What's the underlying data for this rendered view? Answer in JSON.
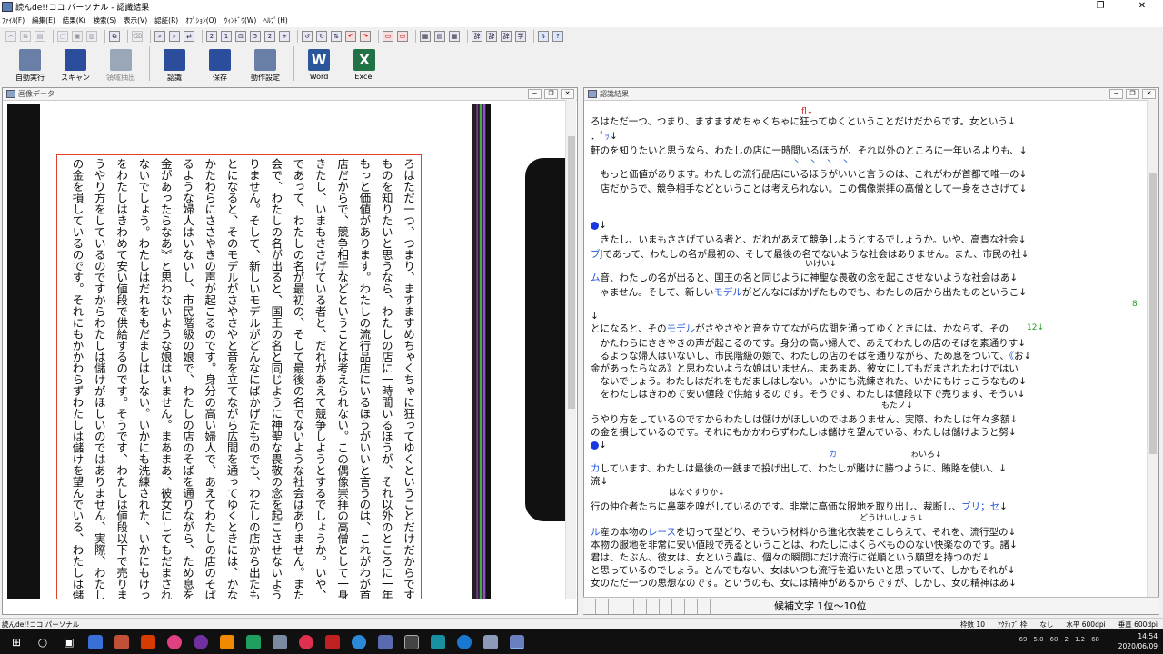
{
  "window": {
    "title": "読んde!!ココ パーソナル - 認識結果",
    "min": "─",
    "max": "❐",
    "close": "✕"
  },
  "menu": [
    "ﾌｧｲﾙ(F)",
    "編集(E)",
    "結果(K)",
    "検索(S)",
    "表示(V)",
    "認証(R)",
    "ｵﾌﾟｼｮﾝ(O)",
    "ｳｨﾝﾄﾞｳ(W)",
    "ﾍﾙﾌﾟ(H)"
  ],
  "toolbar2": [
    {
      "label": "自動実行",
      "color": "#6a7fa8"
    },
    {
      "label": "スキャン",
      "color": "#2c4c9c"
    },
    {
      "label": "領域抽出",
      "color": "#9aa7b8"
    },
    {
      "label": "認識",
      "color": "#2c4c9c"
    },
    {
      "label": "保存",
      "color": "#2c4c9c"
    },
    {
      "label": "動作設定",
      "color": "#6a7fa8"
    },
    {
      "label": "Word",
      "color": "#2b579a",
      "letter": "W"
    },
    {
      "label": "Excel",
      "color": "#217346",
      "letter": "X"
    }
  ],
  "image_panel": {
    "title": "画像データ"
  },
  "result_panel": {
    "title": "認識結果"
  },
  "vertical_text": [
    "ろはただ一つ、つまり、ますますめちゃくちゃに狂ってゆくということだけだからです",
    "ものを知りたいと思うなら、わたしの店に一時間いるほうが、それ以外のところに一年",
    "もっと価値があります。わたしの流行品店にいるほうがいいと言うのは、これがわが首",
    "店だからで、競争相手などということは考えられない。この偶像崇拝の高僧として一身",
    "きたし、いまもささげている者と、だれがあえて競争しようとするでしょうか。いや、",
    "であって、わたしの名が最初の、そして最後の名でないような社会はありません。また",
    "会で、わたしの名が出ると、国王の名と同じように神聖な畏敬の念を起こさせないよう",
    "りません。そして、新しいモデルがどんなにばかげたものでも、わたしの店から出たも",
    "とになると、そのモデルがさやさやと音を立てながら広間を通ってゆくときには、かな",
    "かたわらにささやきの声が起こるのです。身分の高い婦人で、あえてわたしの店のそば",
    "るような婦人はいないし、市民階級の娘で、わたしの店のそばを通りながら、ため息を",
    "金があったらなあ》と思わないような娘はいません。まあまあ、彼女にしてもだまされ",
    "ないでしょう。わたしはだれをもだましはしない。いかにも洗練された、いかにもけっ",
    "をわたしはきわめて安い値段で供給するのです。そうです、わたしは値段以下で売りま",
    "うやり方をしているのですからわたしは儲けがほしいのではありません、実際、わたし",
    "の金を損しているのです。それにもかかわらずわたしは儲けを望んでいる、わたしは儲"
  ],
  "result_lines": [
    {
      "segs": [
        {
          "t": "ろはただ一つ、つまり、ますますめちゃくちゃに狂ってゆくということだけだからです。女という↓"
        }
      ]
    },
    {
      "segs": [
        {
          "t": "．"
        },
        {
          "t": "ﾟｯ",
          "c": "bl"
        },
        {
          "t": "↓"
        }
      ]
    },
    {
      "segs": [
        {
          "t": "軒のを知りたいと思うなら、わたしの店に一時間いるほうが、それ以外のところに一年いるよりも、↓"
        }
      ]
    },
    {
      "segs": [
        {
          "t": "　もっと価値があります。わたしの流行品店にいるほうがいいと言うのは、これがわが首都で唯一の↓"
        }
      ]
    },
    {
      "segs": [
        {
          "t": "　店だからで、競争相手などということは考えられない。この偶像崇拝の高僧として一身をささげて↓"
        }
      ]
    },
    {
      "segs": [
        {
          "t": "●",
          "c": "dot"
        },
        {
          "t": "↓"
        }
      ]
    },
    {
      "segs": [
        {
          "t": "　きたし、いまもささげている者と、だれがあえて競争しようとするでしょうか。いや、高貴な社会↓"
        }
      ]
    },
    {
      "segs": [
        {
          "t": "ブJ",
          "c": "bl"
        },
        {
          "t": "であって、わたしの名が最初の、そして最後の名でないような社会はありません。また、市民の社↓"
        }
      ]
    },
    {
      "segs": [
        {
          "t": "ム",
          "c": "bl"
        },
        {
          "t": "音、わたしの名が出ると、国王の名と同じように神聖な畏敬の念を起こさせないような社会はあ↓"
        }
      ]
    },
    {
      "segs": [
        {
          "t": "　ゃません。そして、新しい"
        },
        {
          "t": "モデル",
          "c": "bl"
        },
        {
          "t": "がどんなにばかげたものでも、わたしの店から出たものというこ↓"
        }
      ]
    },
    {
      "segs": [
        {
          "t": "↓"
        }
      ]
    },
    {
      "segs": [
        {
          "t": "とになると、その"
        },
        {
          "t": "モデル",
          "c": "bl"
        },
        {
          "t": "がさやさやと音を立てながら広間を通ってゆくときには、かならず、その"
        }
      ]
    },
    {
      "segs": [
        {
          "t": "　かたわらにささやきの声が起こるのです。身分の高い婦人で、あえてわたしの店のそばを素通りす↓"
        }
      ]
    },
    {
      "segs": [
        {
          "t": "　るような婦人はいないし、市民階級の娘で、わたしの店のそばを通りながら、ため息をついて、"
        },
        {
          "t": "《",
          "c": "bl"
        },
        {
          "t": "お↓"
        }
      ]
    },
    {
      "segs": [
        {
          "t": "金があったらなあ》と思わないような娘はいません。まあまあ、彼女にしてもだまされたわけではい"
        }
      ]
    },
    {
      "segs": [
        {
          "t": "　ないでしょう。わたしはだれをもだましはしない。いかにも洗練された、いかにもけっこうなもの↓"
        }
      ]
    },
    {
      "segs": [
        {
          "t": "　をわたしはきわめて安い値段で供給するのです。そうです、わたしは値段以下で売ります、そうい↓"
        }
      ]
    },
    {
      "segs": [
        {
          "t": "うやり方をしているのですからわたしは儲けがほしいのではありません、実際、わたしは年々多額↓"
        }
      ]
    },
    {
      "segs": [
        {
          "t": "の金を損しているのです。それにもかかわらずわたしは儲けを望んでいる、わたしは儲けようと努↓"
        }
      ]
    },
    {
      "segs": [
        {
          "t": "●",
          "c": "dot"
        },
        {
          "t": "↓"
        }
      ]
    },
    {
      "segs": [
        {
          "t": "カ",
          "c": "bl"
        },
        {
          "t": "しています、わたしは最後の一銭まで投げ出して、わたしが賭けに勝つように、賄賂を使い、↓"
        }
      ]
    },
    {
      "segs": [
        {
          "t": "流↓"
        }
      ]
    },
    {
      "segs": [
        {
          "t": "行の仲介者たちに鼻薬を嗅がしているのです。非常に高価な服地を取り出し、裁断し、"
        },
        {
          "t": "ブリ；セ",
          "c": "bl"
        },
        {
          "t": "↓"
        }
      ]
    },
    {
      "segs": [
        {
          "t": "ル",
          "c": "bl"
        },
        {
          "t": "産の本物の"
        },
        {
          "t": "レース",
          "c": "bl"
        },
        {
          "t": "を切って型どり、そういう材料から進化衣装をこしらえて、それを、流行型の↓"
        }
      ]
    },
    {
      "segs": [
        {
          "t": "本物の服地を非常に安い値段で売るということは、わたしにはくらべもののない快楽なのです。諸↓"
        }
      ]
    },
    {
      "segs": [
        {
          "t": "君は、たぶん、彼女は、女という蟲は、個々の瞬間にだけ流行に従順という願望を持つのだ↓"
        }
      ]
    },
    {
      "segs": [
        {
          "t": "と思っているのでしょう。とんでもない、女はいつも流行を追いたいと思っていて、しかもそれが↓"
        }
      ]
    },
    {
      "segs": [
        {
          "t": "女のただ一つの思想なのです。というのも、女には精神があるからですが、しかし、女の精神はあ↓"
        }
      ]
    }
  ],
  "ruby_notes": [
    {
      "t": "fl↓",
      "c": "rd",
      "pos": "r1"
    },
    {
      "t": "丶　丶　丶　丶",
      "c": "bl",
      "pos": "r2"
    },
    {
      "t": "いけい↓",
      "c": "",
      "pos": "r3"
    },
    {
      "t": "12↓",
      "c": "gr",
      "pos": "r4"
    },
    {
      "t": "8",
      "c": "gr",
      "pos": "r5"
    },
    {
      "t": "もたノ↓",
      "c": "",
      "pos": "r6"
    },
    {
      "t": "カ",
      "c": "bl",
      "pos": "r7"
    },
    {
      "t": "ゎいろ↓",
      "c": "",
      "pos": "r8"
    },
    {
      "t": "はなぐすりか↓",
      "c": "",
      "pos": "r9"
    },
    {
      "t": "どうけいしょぅ↓",
      "c": "",
      "pos": "r10"
    }
  ],
  "candidate": {
    "text": "候補文字 1位〜10位"
  },
  "status": {
    "left": "読んde!!ココ パーソナル",
    "right": [
      "枠数 10",
      "ｱｸﾃｨﾌﾞ 枠",
      "なし",
      "水平 600dpi",
      "垂直 600dpi"
    ]
  },
  "taskbar": {
    "tray": [
      "69",
      "5.0",
      "60",
      "2",
      "1.2",
      "68"
    ],
    "time": "14:54",
    "date": "2020/06/09"
  }
}
